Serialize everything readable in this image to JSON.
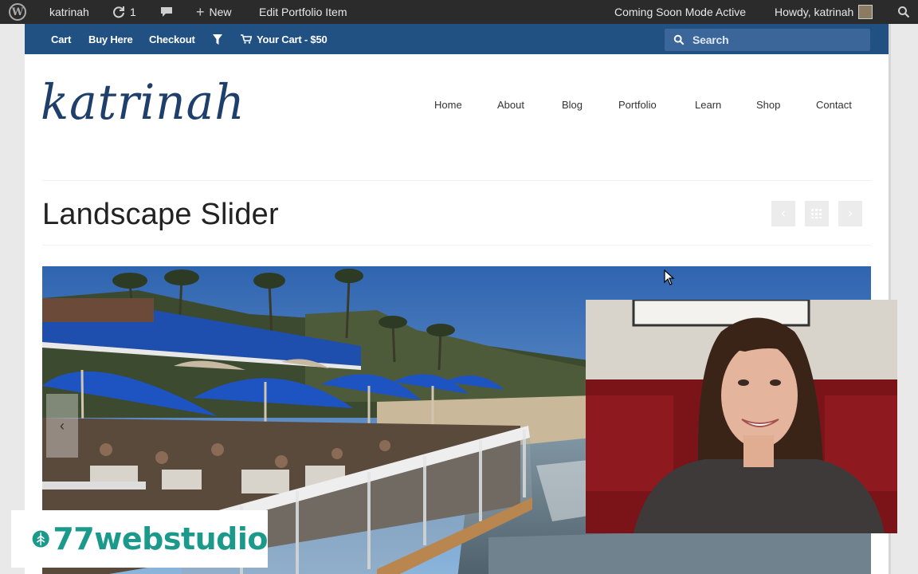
{
  "adminbar": {
    "site_name": "katrinah",
    "updates_count": "1",
    "new_label": "New",
    "edit_label": "Edit Portfolio Item",
    "coming_soon": "Coming Soon Mode Active",
    "howdy": "Howdy, katrinah"
  },
  "topbar": {
    "cart": "Cart",
    "buy_here": "Buy Here",
    "checkout": "Checkout",
    "your_cart": "Your Cart - $50",
    "search_placeholder": "Search"
  },
  "site": {
    "logo": "katrinah",
    "nav": [
      "Home",
      "About",
      "Blog",
      "Portfolio",
      "Learn",
      "Shop",
      "Contact"
    ]
  },
  "main": {
    "title": "Landscape Slider"
  },
  "watermark": {
    "text": "77webstudio"
  },
  "colors": {
    "adminbar": "#2b2b2b",
    "topbar": "#215083",
    "logo": "#1e3e6b",
    "brand": "#1b9a8c"
  }
}
